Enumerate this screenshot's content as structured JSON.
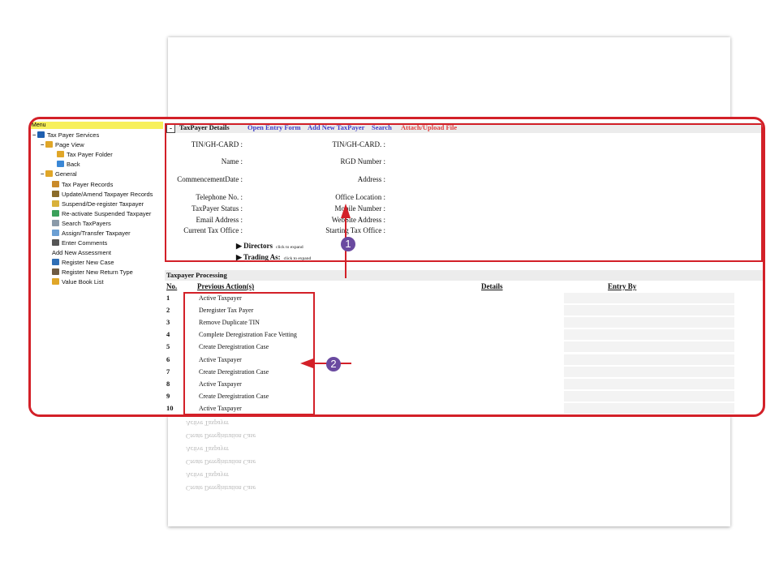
{
  "sidebar": {
    "menu_label": "Menu",
    "items": [
      {
        "label": "Tax Payer Services",
        "icon": "book-icon",
        "toggle": "−"
      },
      {
        "label": "Page View",
        "icon": "folder-icon",
        "toggle": "−"
      },
      {
        "label": "Tax Payer Folder",
        "icon": "folder-icon"
      },
      {
        "label": "Back",
        "icon": "back-icon"
      },
      {
        "label": "General",
        "icon": "folder-icon",
        "toggle": "−"
      },
      {
        "label": "Tax Payer Records",
        "icon": "people-icon"
      },
      {
        "label": "Update/Amend Taxpayer Records",
        "icon": "edit-icon"
      },
      {
        "label": "Suspend/De-register Taxpayer",
        "icon": "lock-icon"
      },
      {
        "label": "Re-activate Suspended Taxpayer",
        "icon": "refresh-icon"
      },
      {
        "label": "Search TaxPayers",
        "icon": "search-icon"
      },
      {
        "label": "Assign/Transfer Taxpayer",
        "icon": "assign-icon"
      },
      {
        "label": "Enter Comments",
        "icon": "comment-icon"
      },
      {
        "label": "Add New Assessment",
        "icon": ""
      },
      {
        "label": "Register New Case",
        "icon": "case-icon"
      },
      {
        "label": "Register New Return Type",
        "icon": "return-icon"
      },
      {
        "label": "Value Book List",
        "icon": "value-icon"
      }
    ]
  },
  "details": {
    "toggle": "-",
    "title": "TaxPayer Details",
    "links": {
      "open_entry": "Open Entry Form",
      "add_new": "Add New TaxPayer",
      "search": "Search",
      "attach": "Attach/Upload File"
    },
    "left_fields": [
      "TIN/GH-CARD :",
      "Name :",
      "CommencementDate :",
      "Telephone No. :",
      "TaxPayer Status :",
      "Email Address :",
      "Current Tax Office :"
    ],
    "right_fields": [
      "TIN/GH-CARD. :",
      "RGD Number :",
      "Address :",
      "Office Location :",
      "Mobile Number :",
      "WebSite Address :",
      "Starting Tax Office :"
    ],
    "directors": "Directors",
    "trading": "Trading As:",
    "click_hint": "click to expand"
  },
  "processing": {
    "title": "Taxpayer Processing",
    "columns": {
      "no": "No.",
      "previous": "Previous Action(s)",
      "details": "Details",
      "entry_by": "Entry By"
    },
    "rows": [
      {
        "no": "1",
        "action": "Active Taxpayer"
      },
      {
        "no": "2",
        "action": "Deregister Tax Payer"
      },
      {
        "no": "3",
        "action": "Remove Duplicate TIN"
      },
      {
        "no": "4",
        "action": "Complete Deregistration Face Vetting"
      },
      {
        "no": "5",
        "action": "Create Deregistration Case"
      },
      {
        "no": "6",
        "action": "Active Taxpayer"
      },
      {
        "no": "7",
        "action": "Create Deregistration Case"
      },
      {
        "no": "8",
        "action": "Active Taxpayer"
      },
      {
        "no": "9",
        "action": "Create Deregistration Case"
      },
      {
        "no": "10",
        "action": "Active Taxpayer"
      }
    ]
  },
  "callouts": {
    "one": "1",
    "two": "2"
  },
  "colors": {
    "highlight": "#d32028",
    "badge": "#6a4aa0",
    "menu_bg": "#f7f05b",
    "link": "#3f3fc8",
    "link_red": "#e04040"
  }
}
